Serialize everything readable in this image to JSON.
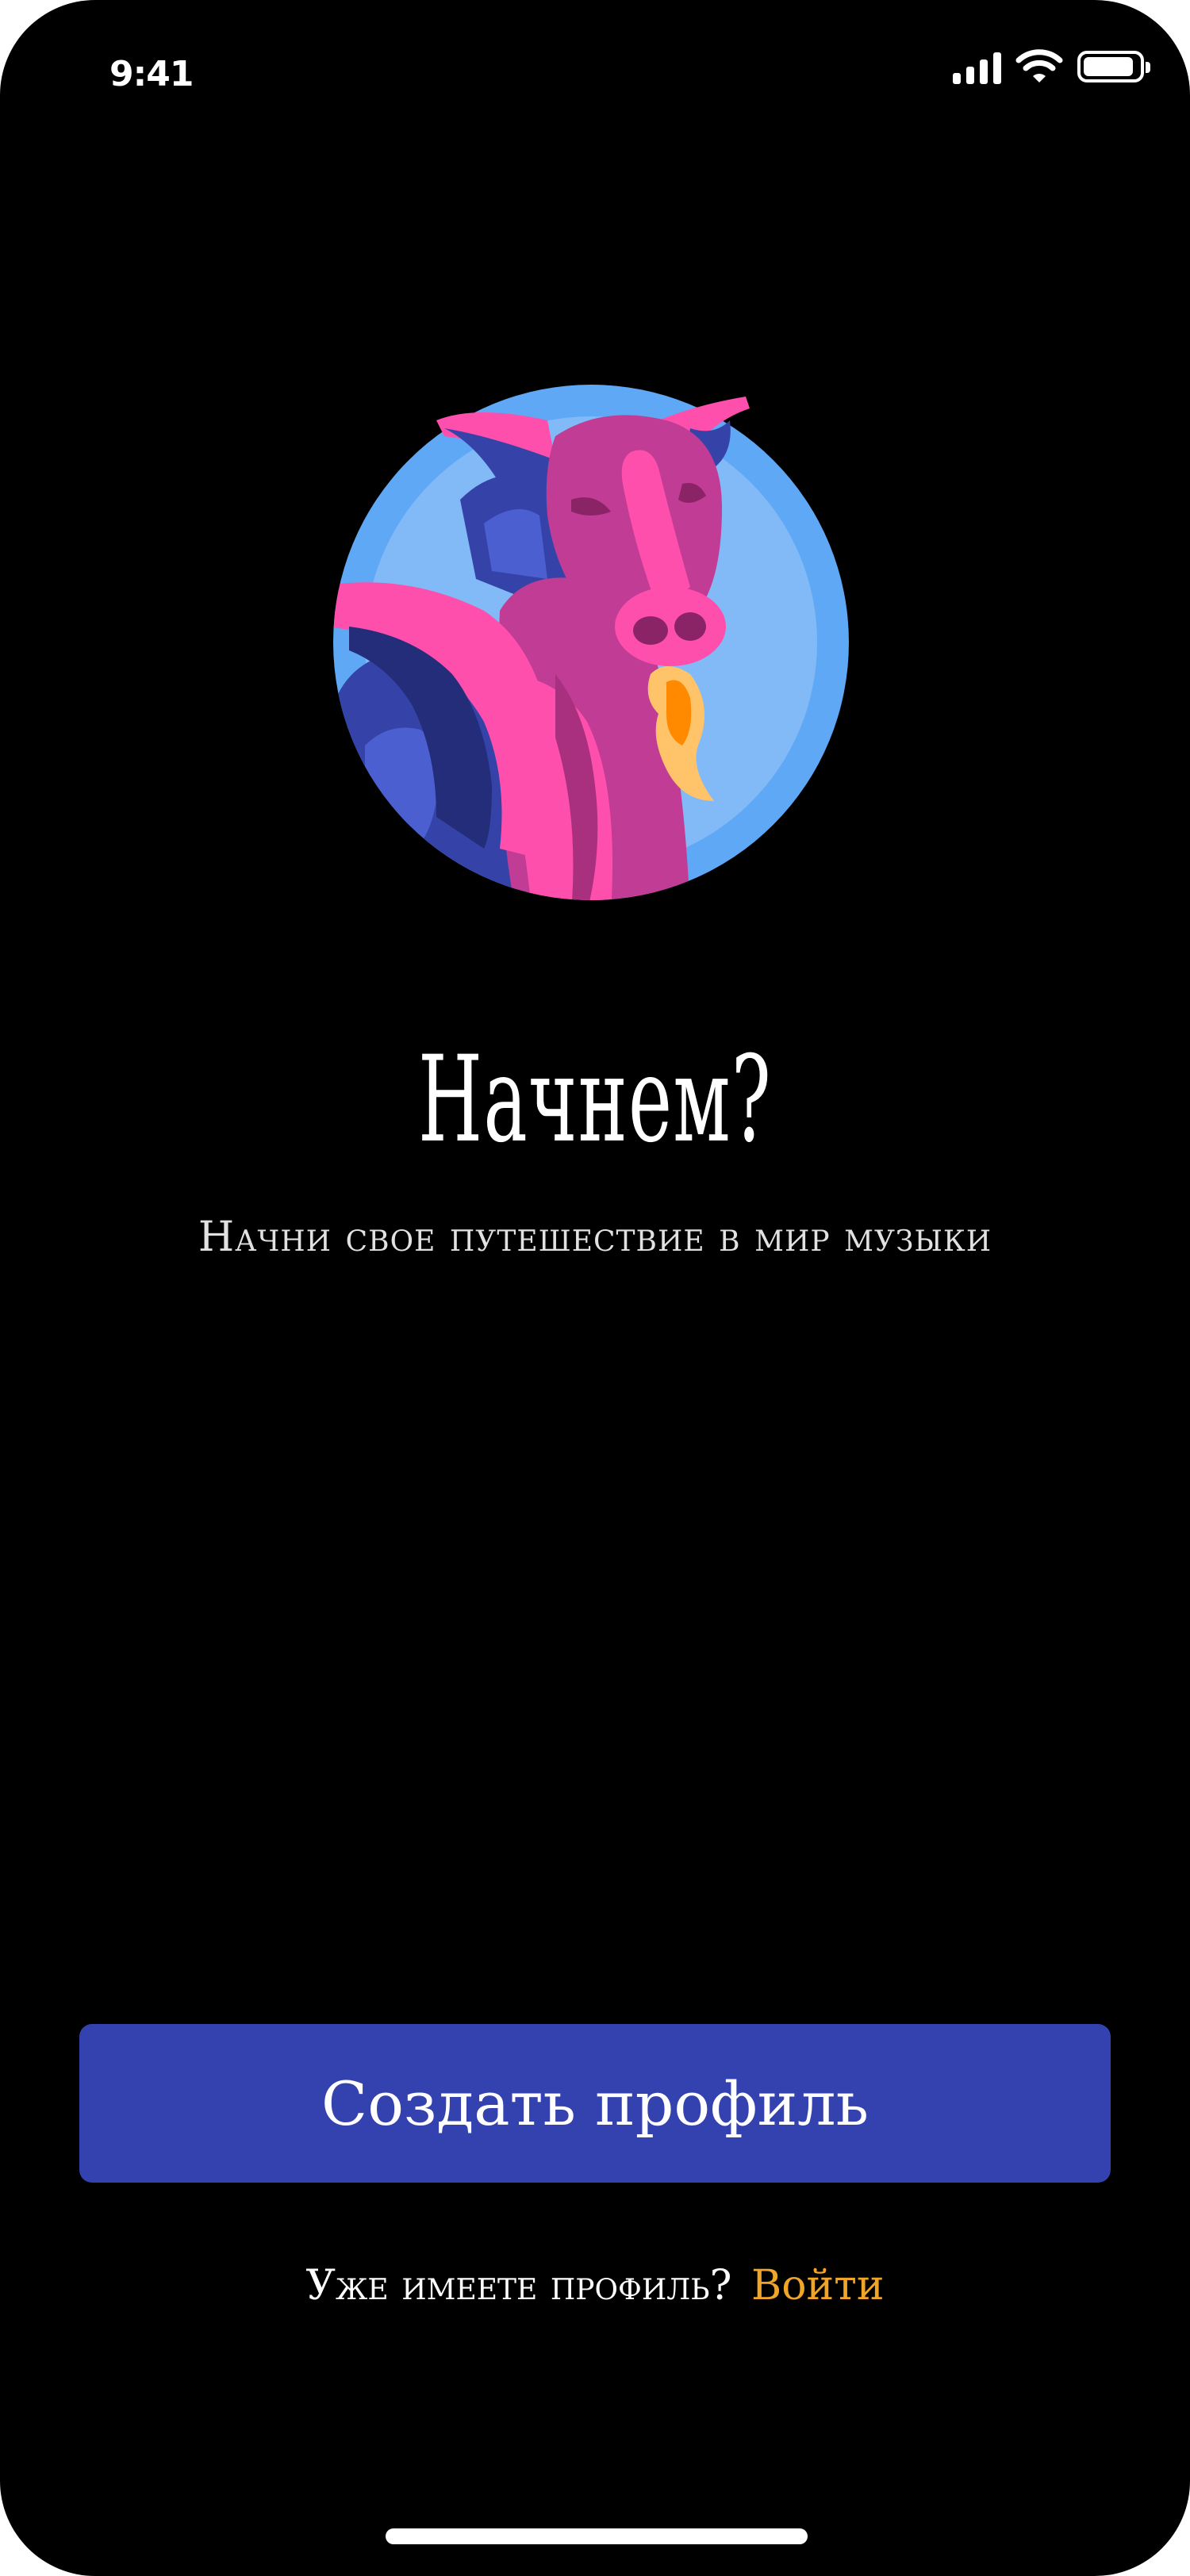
{
  "status_bar": {
    "time": "9:41",
    "icons": [
      "signal-icon",
      "wifi-icon",
      "battery-icon"
    ]
  },
  "illustration": {
    "name": "dragon-illustration",
    "colors": {
      "circle_outer": "#5ea8f5",
      "circle_inner": "#82b9f7",
      "dragon_body": "#c03c95",
      "dragon_pink": "#ff4fad",
      "wing": "#3543a8",
      "wing_dark": "#242d7a",
      "flame": "#ffc46a",
      "flame_core": "#ff8a00"
    }
  },
  "welcome": {
    "title": "Начнем?",
    "subtitle": "Начни свое путешествие в мир музыки"
  },
  "actions": {
    "create_profile_label": "Создать профиль",
    "have_profile_text": "Уже имеете профиль?",
    "login_label": "Войти"
  },
  "colors": {
    "background": "#000000",
    "primary_button": "#3442b0",
    "accent": "#f0a52a",
    "text": "#ffffff"
  }
}
